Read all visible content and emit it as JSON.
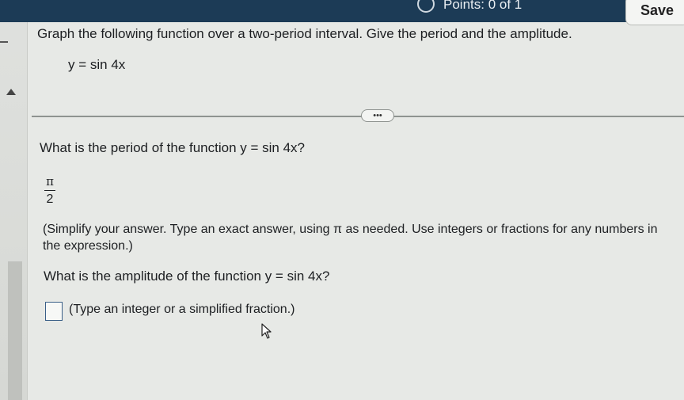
{
  "header": {
    "points_text": "Points: 0 of 1",
    "save_label": "Save"
  },
  "question": {
    "instruction": "Graph the following function over a two-period interval. Give the period and the amplitude.",
    "equation": "y = sin 4x",
    "more_label": "•••"
  },
  "period": {
    "prompt": "What is the period of the function y = sin 4x?",
    "answer_numerator": "π",
    "answer_denominator": "2",
    "hint": "(Simplify your answer. Type an exact answer, using π as needed. Use integers or fractions for any numbers in the expression.)"
  },
  "amplitude": {
    "prompt": "What is the amplitude of the function y = sin 4x?",
    "input_value": "",
    "hint": "(Type an integer or a simplified fraction.)"
  },
  "colors": {
    "header_bg": "#1c3b56",
    "input_border": "#3a5f87"
  },
  "icons": [
    "points-circle-icon",
    "cursor-icon",
    "collapse-arrow-icon"
  ]
}
